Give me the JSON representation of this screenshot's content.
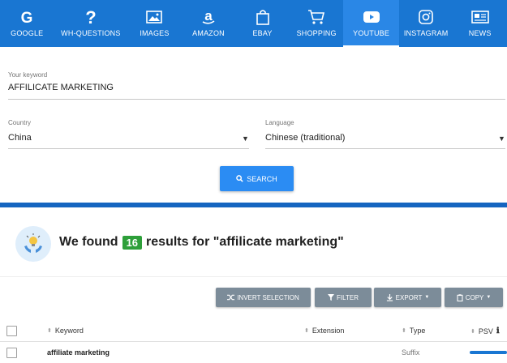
{
  "nav": {
    "tabs": [
      {
        "label": "GOOGLE",
        "icon": "google-icon"
      },
      {
        "label": "WH-QUESTIONS",
        "icon": "question-icon"
      },
      {
        "label": "IMAGES",
        "icon": "image-icon"
      },
      {
        "label": "AMAZON",
        "icon": "amazon-icon"
      },
      {
        "label": "EBAY",
        "icon": "bag-icon"
      },
      {
        "label": "SHOPPING",
        "icon": "cart-icon"
      },
      {
        "label": "YOUTUBE",
        "icon": "youtube-icon",
        "active": true
      },
      {
        "label": "INSTAGRAM",
        "icon": "instagram-icon"
      },
      {
        "label": "NEWS",
        "icon": "newspaper-icon"
      }
    ]
  },
  "form": {
    "keyword_label": "Your keyword",
    "keyword_value": "AFFILICATE MARKETING",
    "country_label": "Country",
    "country_value": "China",
    "language_label": "Language",
    "language_value": "Chinese (traditional)",
    "search_label": "SEARCH"
  },
  "results": {
    "prefix": "We found",
    "count": "16",
    "suffix": "results for \"affilicate marketing\""
  },
  "toolbar": {
    "invert_label": "INVERT SELECTION",
    "filter_label": "FILTER",
    "export_label": "EXPORT",
    "copy_label": "COPY"
  },
  "table": {
    "headers": {
      "keyword": "Keyword",
      "extension": "Extension",
      "type": "Type",
      "psv": "PSV"
    },
    "rows": [
      {
        "keyword": "affiliate marketing",
        "extension": "",
        "type": "Suffix"
      }
    ]
  },
  "colors": {
    "nav_bg": "#1976d2",
    "search_button": "#2b8cf3",
    "count_badge": "#2e9f3a",
    "toolbar_button": "#7c8c99"
  }
}
